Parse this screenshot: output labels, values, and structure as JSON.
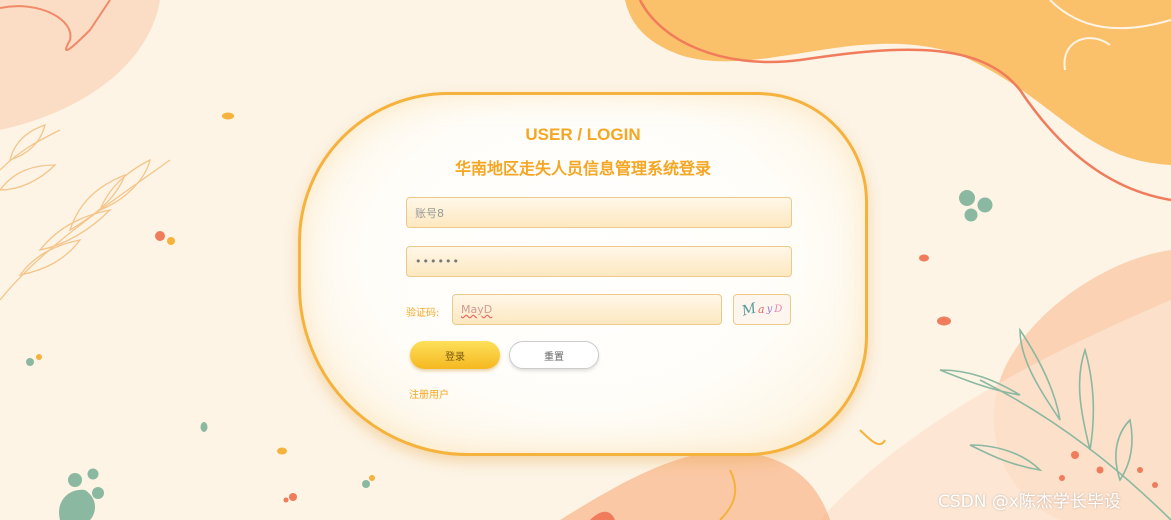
{
  "form": {
    "title_en": "USER / LOGIN",
    "title_cn": "华南地区走失人员信息管理系统登录",
    "account_placeholder": "账号8",
    "password_value": "••••••",
    "captcha_label": "验证码:",
    "captcha_value": "MayD",
    "captcha_chars": [
      "M",
      "a",
      "y",
      "D"
    ],
    "login_label": "登录",
    "reset_label": "重置",
    "register_label": "注册用户"
  },
  "watermark": "CSDN @x陈杰学长毕设",
  "colors": {
    "accent": "#f5a623",
    "peach": "#fbd2b4",
    "orange_blob": "#fbc06a",
    "leaf_green": "#8bb8a0",
    "coral": "#f07c5c"
  }
}
